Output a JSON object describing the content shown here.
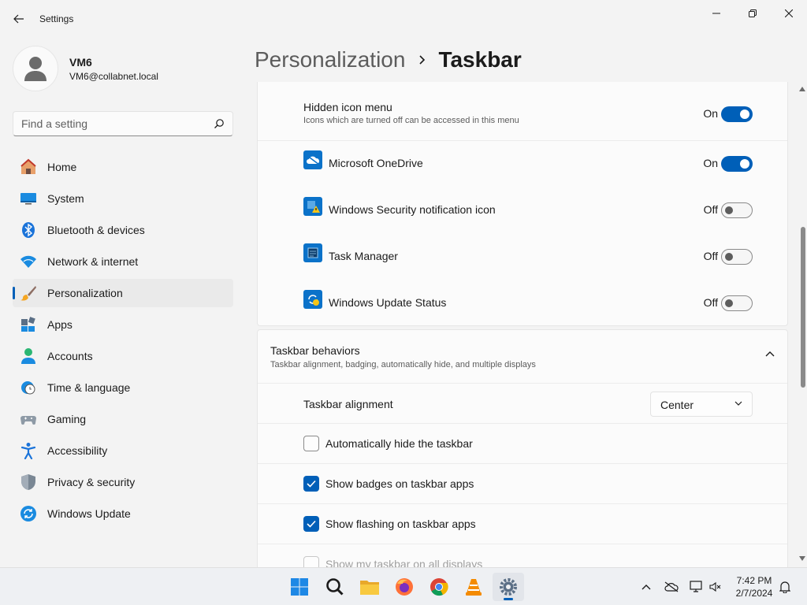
{
  "window": {
    "title": "Settings"
  },
  "profile": {
    "name": "VM6",
    "email": "VM6@collabnet.local"
  },
  "search": {
    "placeholder": "Find a setting"
  },
  "sidebar": {
    "items": [
      {
        "label": "Home",
        "icon": "home-icon"
      },
      {
        "label": "System",
        "icon": "system-icon"
      },
      {
        "label": "Bluetooth & devices",
        "icon": "bluetooth-icon"
      },
      {
        "label": "Network & internet",
        "icon": "wifi-icon"
      },
      {
        "label": "Personalization",
        "icon": "brush-icon",
        "active": true
      },
      {
        "label": "Apps",
        "icon": "apps-icon"
      },
      {
        "label": "Accounts",
        "icon": "accounts-icon"
      },
      {
        "label": "Time & language",
        "icon": "clock-globe-icon"
      },
      {
        "label": "Gaming",
        "icon": "gamepad-icon"
      },
      {
        "label": "Accessibility",
        "icon": "accessibility-icon"
      },
      {
        "label": "Privacy & security",
        "icon": "shield-icon"
      },
      {
        "label": "Windows Update",
        "icon": "update-icon"
      }
    ]
  },
  "breadcrumb": {
    "parent": "Personalization",
    "current": "Taskbar"
  },
  "hidden_icon_menu": {
    "title": "Hidden icon menu",
    "subtitle": "Icons which are turned off can be accessed in this menu",
    "state": "On",
    "apps": [
      {
        "label": "Microsoft OneDrive",
        "state": "On",
        "icon": "onedrive-icon"
      },
      {
        "label": "Windows Security notification icon",
        "state": "Off",
        "icon": "security-warning-icon"
      },
      {
        "label": "Task Manager",
        "state": "Off",
        "icon": "task-manager-icon"
      },
      {
        "label": "Windows Update Status",
        "state": "Off",
        "icon": "update-status-icon"
      }
    ]
  },
  "taskbar_behaviors": {
    "title": "Taskbar behaviors",
    "subtitle": "Taskbar alignment, badging, automatically hide, and multiple displays",
    "alignment_label": "Taskbar alignment",
    "alignment_value": "Center",
    "options": [
      {
        "label": "Automatically hide the taskbar",
        "checked": false
      },
      {
        "label": "Show badges on taskbar apps",
        "checked": true
      },
      {
        "label": "Show flashing on taskbar apps",
        "checked": true
      },
      {
        "label": "Show my taskbar on all displays",
        "checked": false,
        "disabled": true
      }
    ]
  },
  "taskbar": {
    "apps": [
      "start-icon",
      "search-icon",
      "file-explorer-icon",
      "firefox-icon",
      "chrome-icon",
      "vlc-icon",
      "settings-icon"
    ],
    "time": "7:42 PM",
    "date": "2/7/2024"
  },
  "colors": {
    "accent": "#005fb8",
    "background": "#f3f3f3",
    "card": "#fbfbfb"
  }
}
